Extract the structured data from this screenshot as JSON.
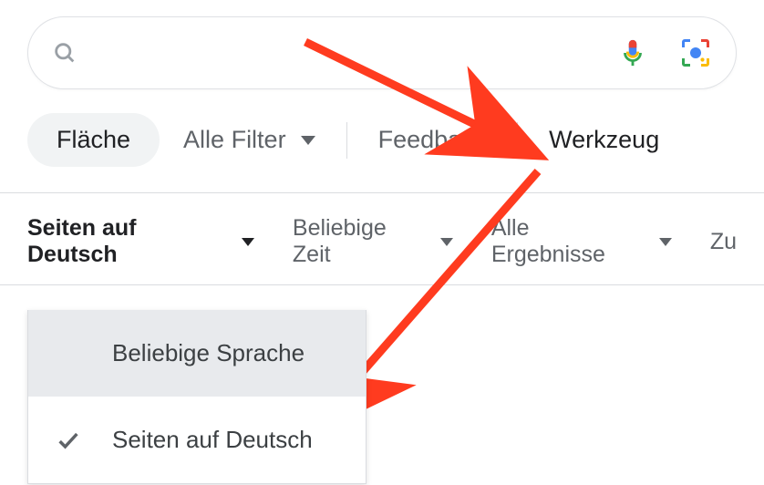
{
  "search": {
    "placeholder": "",
    "value": ""
  },
  "tabs": {
    "chip": "Fläche",
    "all_filters": "Alle Filter",
    "feedback": "Feedback",
    "tools": "Werkzeug"
  },
  "tools_row": {
    "language": "Seiten auf Deutsch",
    "time": "Beliebige Zeit",
    "results": "Alle Ergebnisse",
    "reset": "Zu"
  },
  "menu": {
    "any_language": "Beliebige Sprache",
    "german_pages": "Seiten auf Deutsch"
  }
}
